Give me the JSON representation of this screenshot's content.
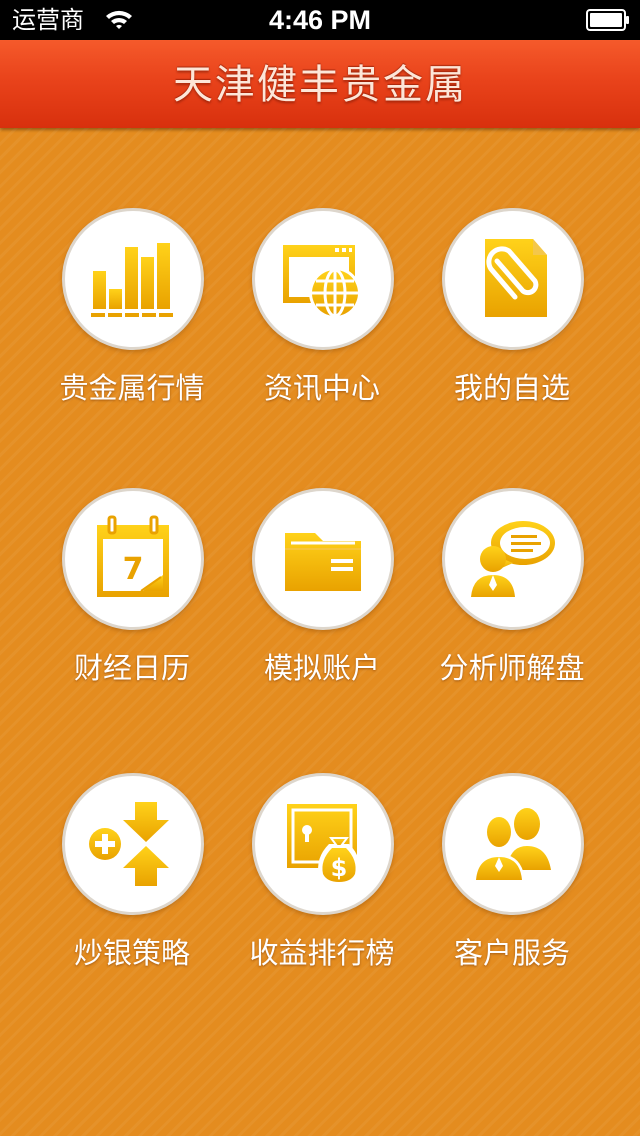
{
  "status_bar": {
    "carrier": "运营商",
    "time": "4:46 PM",
    "wifi_icon": "wifi-icon",
    "battery_icon": "battery-icon"
  },
  "nav": {
    "title": "天津健丰贵金属"
  },
  "colors": {
    "nav_top": "#f55a2b",
    "nav_bottom": "#d8300d",
    "background": "#e48c1f",
    "icon_gold_light": "#ffd21a",
    "icon_gold_dark": "#e9a200"
  },
  "menu": [
    {
      "label": "贵金属行情",
      "icon": "bar-chart-icon"
    },
    {
      "label": "资讯中心",
      "icon": "globe-window-icon"
    },
    {
      "label": "我的自选",
      "icon": "paperclip-document-icon"
    },
    {
      "label": "财经日历",
      "icon": "calendar-icon"
    },
    {
      "label": "模拟账户",
      "icon": "folder-icon"
    },
    {
      "label": "分析师解盘",
      "icon": "analyst-chat-icon"
    },
    {
      "label": "炒银策略",
      "icon": "plus-arrows-icon"
    },
    {
      "label": "收益排行榜",
      "icon": "safe-moneybag-icon"
    },
    {
      "label": "客户服务",
      "icon": "customer-group-icon"
    }
  ]
}
